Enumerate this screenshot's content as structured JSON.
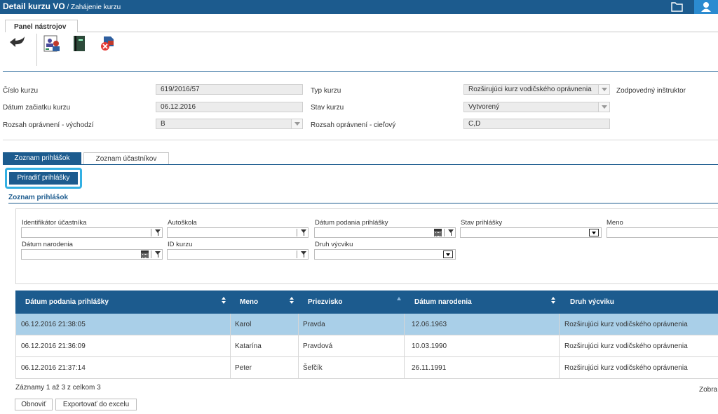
{
  "header": {
    "title": "Detail kurzu VO",
    "breadcrumb": " / Zahájenie kurzu",
    "colors": {
      "bar": "#1c5b8e",
      "user": "#2b8bd0"
    }
  },
  "toolbar": {
    "tab_label": "Panel nástrojov",
    "icons": [
      "back-arrow-icon",
      "person-card-icon",
      "book-icon",
      "cancel-course-icon"
    ]
  },
  "course": {
    "cislo_kurzu_label": "Číslo kurzu",
    "cislo_kurzu_value": "619/2016/57",
    "datum_zaciatku_label": "Dátum začiatku kurzu",
    "datum_zaciatku_value": "06.12.2016",
    "rozsah_vychodzi_label": "Rozsah oprávnení - východzí",
    "rozsah_vychodzi_value": "B",
    "typ_kurzu_label": "Typ kurzu",
    "typ_kurzu_value": "Rozširujúci kurz vodičského oprávnenia",
    "stav_kurzu_label": "Stav kurzu",
    "stav_kurzu_value": "Vytvorený",
    "rozsah_cielovy_label": "Rozsah oprávnení - cieľový",
    "rozsah_cielovy_value": "C,D",
    "instruktor_label": "Zodpovedný inštruktor"
  },
  "tabs": [
    {
      "label": "Zoznam prihlášok",
      "active": true
    },
    {
      "label": "Zoznam účastníkov",
      "active": false
    }
  ],
  "assign_button": "Priradiť prihlášky",
  "section_title": "Zoznam prihlášok",
  "filters": {
    "identifikator": "Identifikátor účastníka",
    "autoskola": "Autoškola",
    "datum_podania": "Dátum podania prihlášky",
    "stav_prihlasky": "Stav prihlášky",
    "meno": "Meno",
    "datum_narodenia": "Dátum narodenia",
    "id_kurzu": "ID kurzu",
    "druh_vycviku": "Druh výcviku"
  },
  "table": {
    "columns": [
      "Dátum podania prihlášky",
      "Meno",
      "Priezvisko",
      "Dátum narodenia",
      "Druh výcviku"
    ],
    "rows": [
      {
        "datum_podania": "06.12.2016 21:38:05",
        "meno": "Karol",
        "priezvisko": "Pravda",
        "datum_narodenia": "12.06.1963",
        "druh": "Rozširujúci kurz vodičského oprávnenia",
        "selected": true
      },
      {
        "datum_podania": "06.12.2016 21:36:09",
        "meno": "Katarína",
        "priezvisko": "Pravdová",
        "datum_narodenia": "10.03.1990",
        "druh": "Rozširujúci kurz vodičského oprávnenia",
        "selected": false
      },
      {
        "datum_podania": "06.12.2016 21:37:14",
        "meno": "Peter",
        "priezvisko": "Šefčík",
        "datum_narodenia": "26.11.1991",
        "druh": "Rozširujúci kurz vodičského oprávnenia",
        "selected": false
      }
    ]
  },
  "footer": {
    "records": "Záznamy 1 až 3 z celkom 3",
    "zobrazit": "Zobra",
    "refresh": "Obnoviť",
    "export": "Exportovať do excelu"
  }
}
